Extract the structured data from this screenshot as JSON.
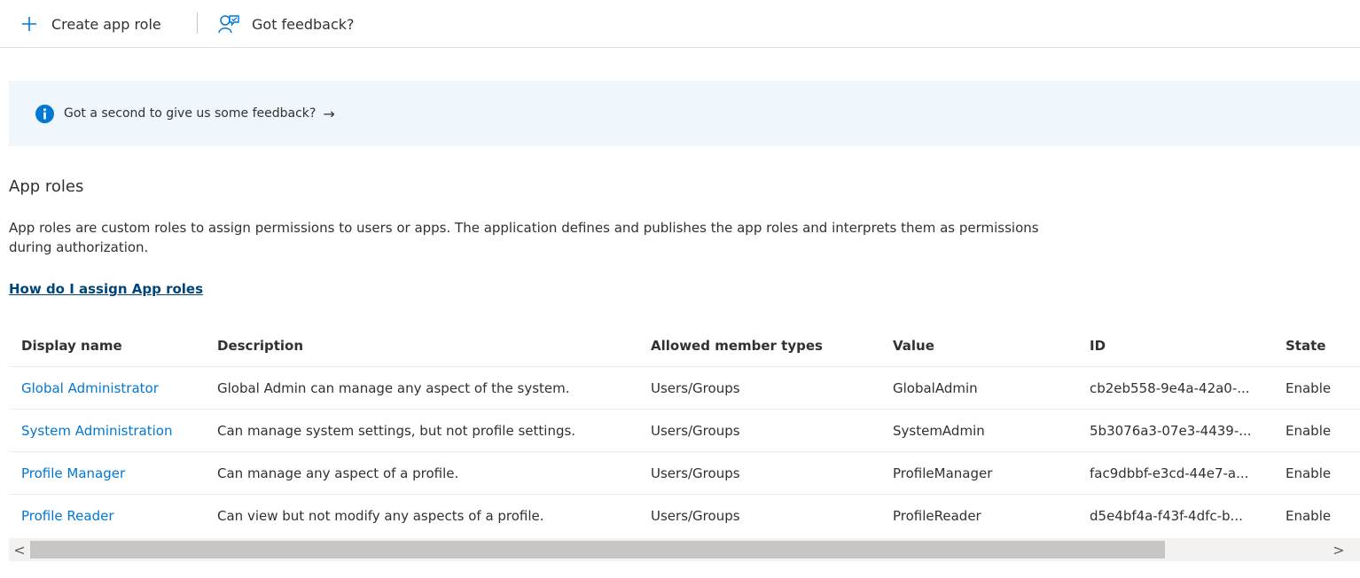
{
  "toolbar": {
    "create_label": "Create app role",
    "create_icon": "plus-icon",
    "feedback_label": "Got feedback?",
    "feedback_icon": "feedback-person-icon"
  },
  "banner": {
    "icon": "info-icon",
    "message": "Got a second to give us some feedback?",
    "arrow": "→",
    "accent_color": "#0078d4",
    "background_color": "#eff6fc"
  },
  "section": {
    "title": "App roles",
    "description": "App roles are custom roles to assign permissions to users or apps. The application defines and publishes the app roles and interprets them as permissions during authorization.",
    "help_link": "How do I assign App roles"
  },
  "table": {
    "columns": [
      "Display name",
      "Description",
      "Allowed member types",
      "Value",
      "ID",
      "State"
    ],
    "rows": [
      [
        "Global Administrator",
        "Global Admin can manage any aspect of the system.",
        "Users/Groups",
        "GlobalAdmin",
        "cb2eb558-9e4a-42a0-...",
        "Enable"
      ],
      [
        "System Administration",
        "Can manage system settings, but not profile settings.",
        "Users/Groups",
        "SystemAdmin",
        "5b3076a3-07e3-4439-...",
        "Enable"
      ],
      [
        "Profile Manager",
        "Can manage any aspect of a profile.",
        "Users/Groups",
        "ProfileManager",
        "fac9dbbf-e3cd-44e7-a...",
        "Enable"
      ],
      [
        "Profile Reader",
        "Can view but not modify any aspects of a profile.",
        "Users/Groups",
        "ProfileReader",
        "d5e4bf4a-f43f-4dfc-b...",
        "Enable"
      ]
    ]
  },
  "scrollbar": {
    "left_arrow": "<",
    "right_arrow": ">"
  },
  "colors": {
    "link": "#0078d4",
    "help_link": "#004578",
    "text": "#323130"
  }
}
